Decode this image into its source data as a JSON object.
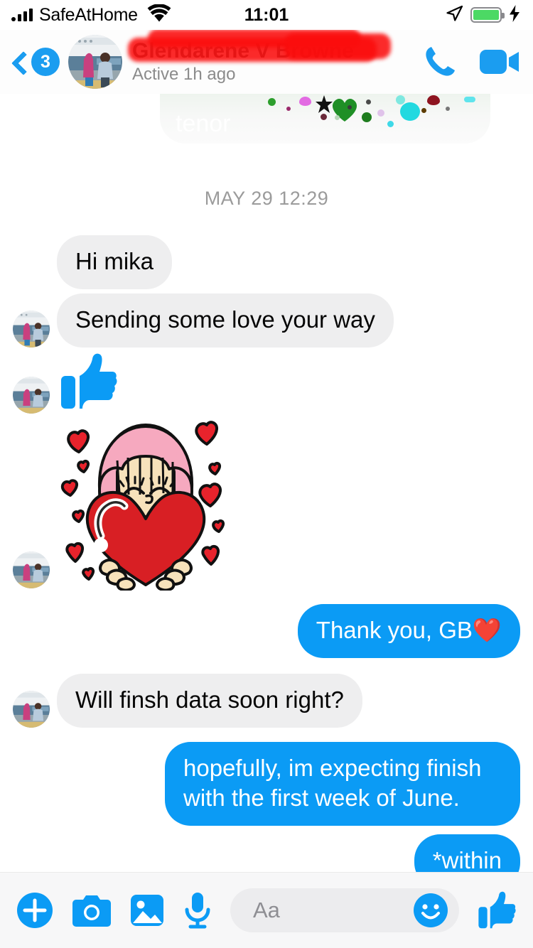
{
  "status_bar": {
    "carrier": "SafeAtHome",
    "time": "11:01",
    "signal_icon": "signal-bars-icon",
    "wifi_icon": "wifi-icon",
    "location_icon": "location-arrow-icon",
    "battery_icon": "battery-full-icon",
    "charging_icon": "lightning-bolt-icon",
    "battery_color": "#4cd964"
  },
  "header": {
    "back_icon": "back-chevron-icon",
    "unread_badge": "3",
    "contact_name": "Glendarene V Browne",
    "contact_name_redacted": true,
    "redaction_color": "#fb0d0d",
    "active_status": "Active 1h ago",
    "avatar_alt": "contact-avatar",
    "call_icon": "phone-call-icon",
    "video_icon": "video-call-icon",
    "accent_color": "#1b9df0"
  },
  "thread": {
    "gif": {
      "watermark": "tenor",
      "type": "animated-gif-attachment",
      "clipped": true
    },
    "timestamp": "MAY 29 12:29",
    "messages": [
      {
        "id": "m1",
        "side": "in",
        "type": "text",
        "text": "Hi mika",
        "avatar": false
      },
      {
        "id": "m2",
        "side": "in",
        "type": "text",
        "text": "Sending some love your way",
        "avatar": true
      },
      {
        "id": "m3",
        "side": "in",
        "type": "sticker",
        "sticker": "thumbs-up-sticker",
        "avatar": true
      },
      {
        "id": "m4",
        "side": "in",
        "type": "sticker",
        "sticker": "girl-hugging-heart-sticker",
        "avatar": true
      },
      {
        "id": "m5",
        "side": "out",
        "type": "text",
        "text": "Thank you, GB❤️"
      },
      {
        "id": "m6",
        "side": "in",
        "type": "text",
        "text": "Will finsh data soon right?",
        "avatar": true
      },
      {
        "id": "m7",
        "side": "out",
        "type": "text",
        "text": "hopefully, im expecting finish with the first week of June."
      },
      {
        "id": "m8",
        "side": "out",
        "type": "text",
        "text": "*within"
      }
    ],
    "bubble_in_color": "#eeeeef",
    "bubble_out_color": "#0b9bf5"
  },
  "composer": {
    "plus_icon": "plus-circle-icon",
    "camera_icon": "camera-icon",
    "gallery_icon": "photo-gallery-icon",
    "mic_icon": "microphone-icon",
    "input_value": "",
    "input_placeholder": "Aa",
    "emoji_icon": "smiley-face-icon",
    "like_icon": "thumbs-up-icon",
    "accent_color": "#0b9bf5"
  }
}
